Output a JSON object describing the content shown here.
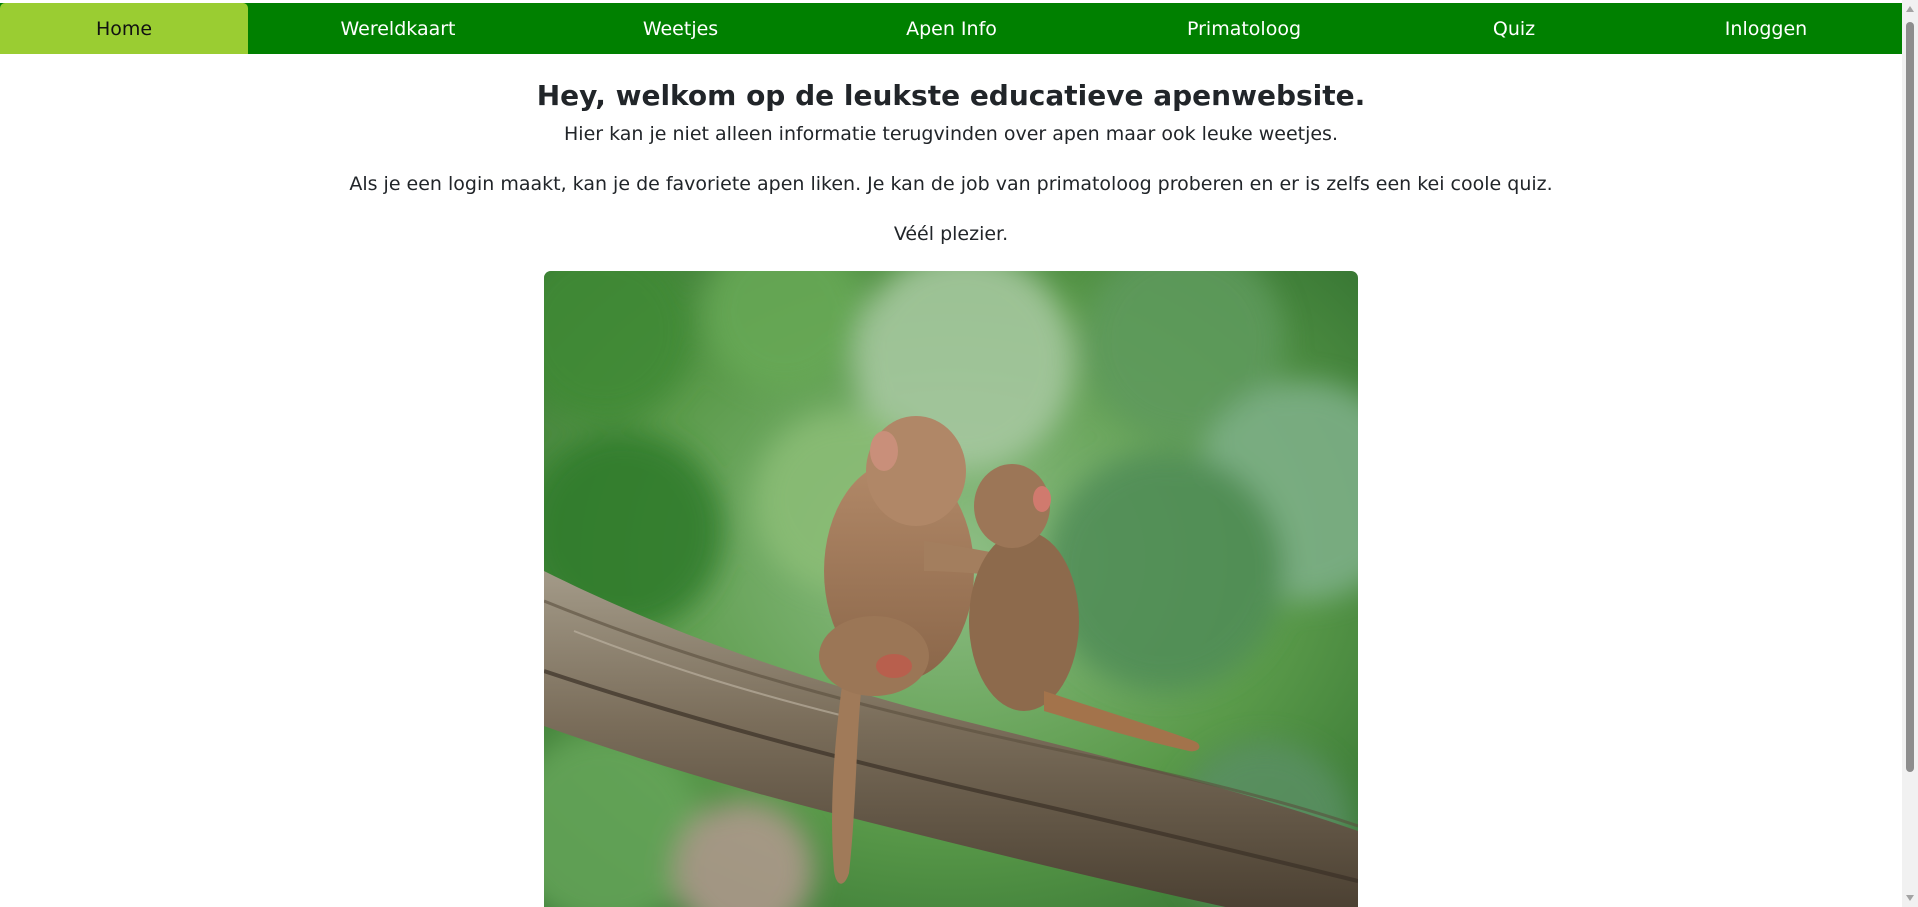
{
  "nav": {
    "items": [
      {
        "label": "Home",
        "active": true
      },
      {
        "label": "Wereldkaart"
      },
      {
        "label": "Weetjes"
      },
      {
        "label": "Apen Info"
      },
      {
        "label": "Primatoloog"
      },
      {
        "label": "Quiz"
      },
      {
        "label": "Inloggen"
      }
    ]
  },
  "main": {
    "title": "Hey, welkom op de leukste educatieve apenwebsite.",
    "intro": "Hier kan je niet alleen informatie terugvinden over apen maar ook leuke weetjes.",
    "paragraph": "Als je een login maakt, kan je de favoriete apen liken. Je kan de job van primatoloog proberen en er is zelfs een kei coole quiz.",
    "closing": "Véél plezier."
  },
  "colors": {
    "nav_bg": "#008000",
    "nav_active": "#9acd32",
    "text": "#212529"
  },
  "icons": {
    "scroll_up": "scroll-up-arrow-icon",
    "scroll_down": "scroll-down-arrow-icon"
  }
}
